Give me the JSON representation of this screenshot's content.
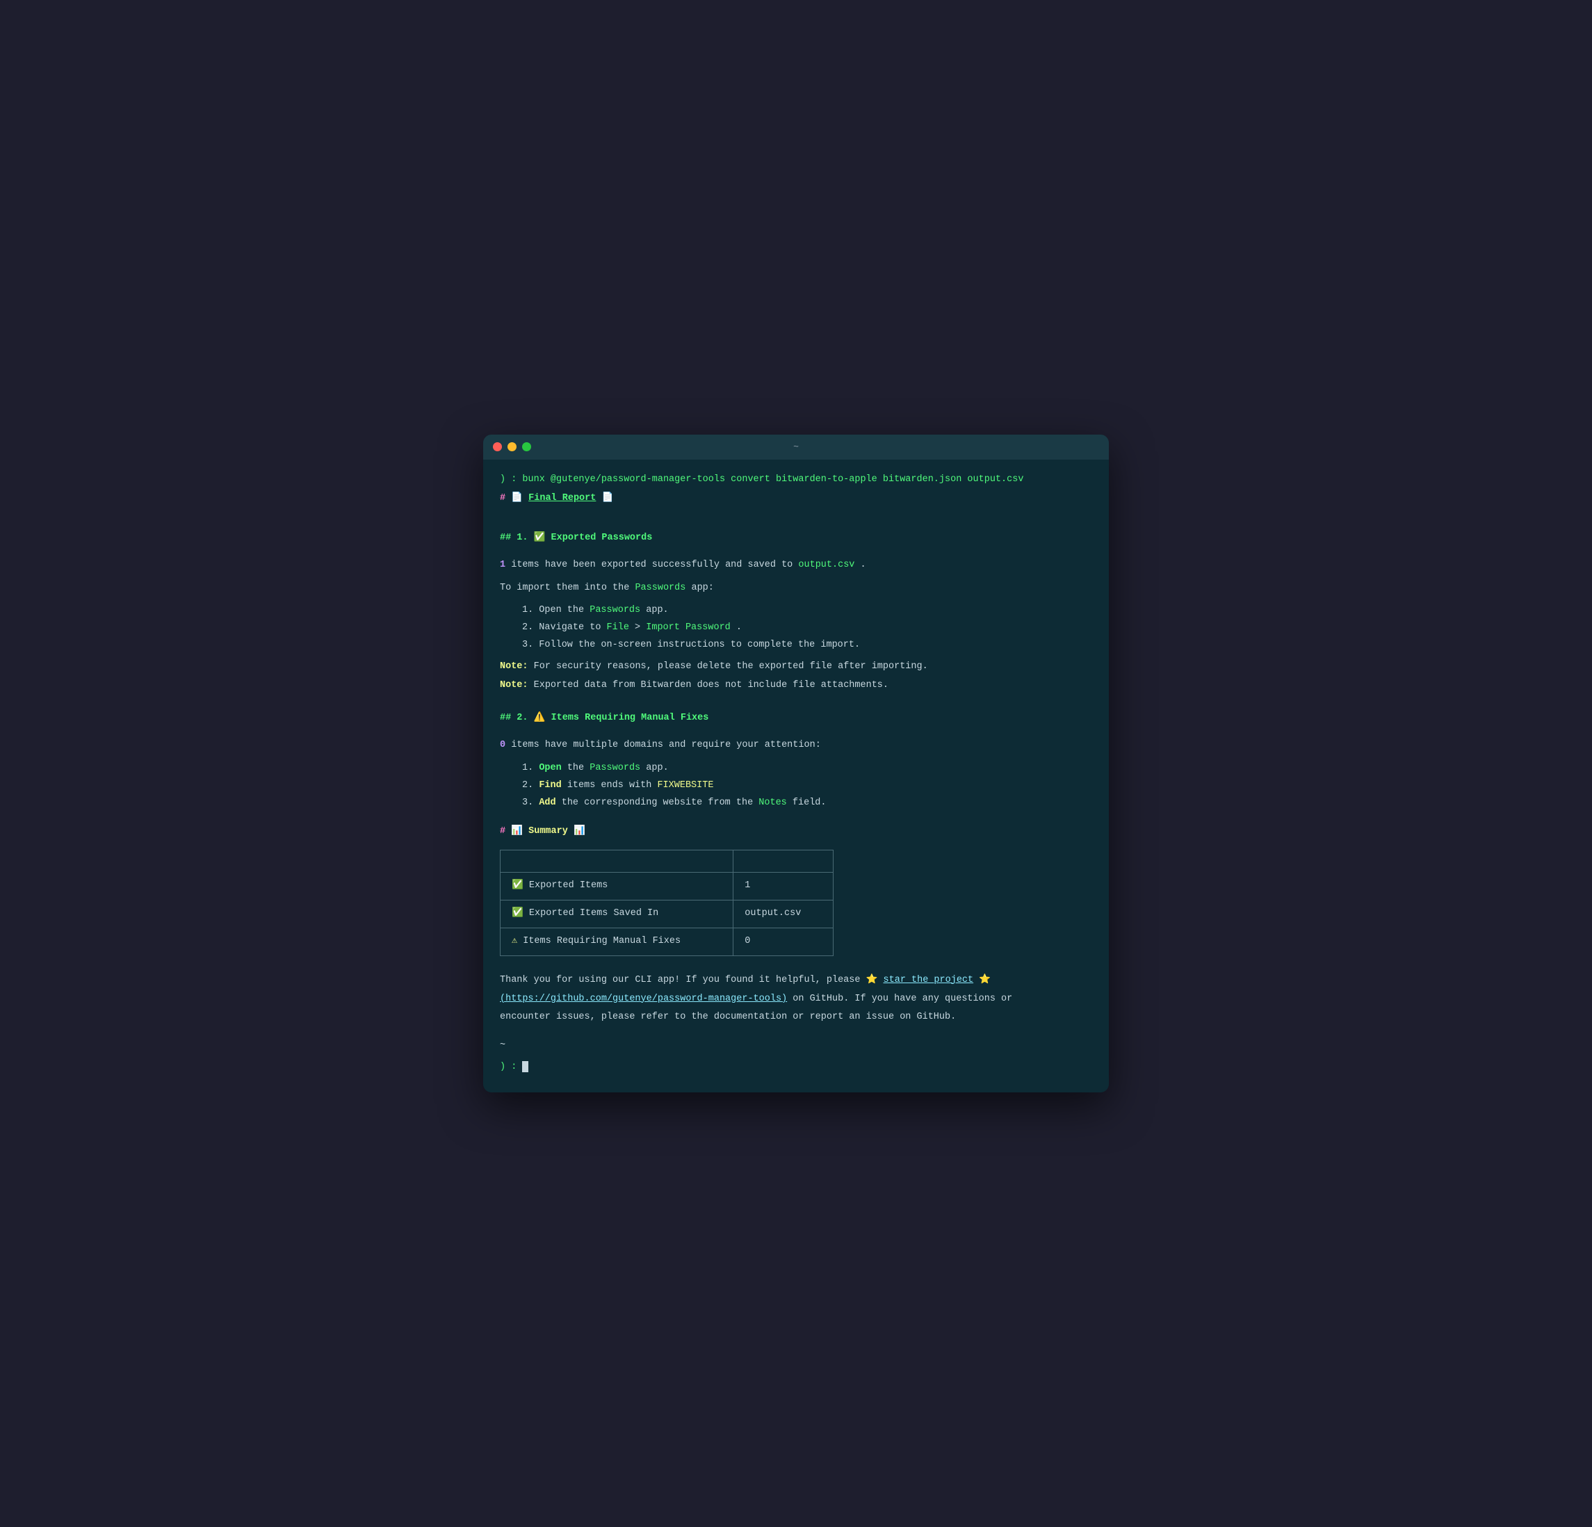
{
  "window": {
    "title": "~"
  },
  "terminal": {
    "command": ") : bunx @gutenye/password-manager-tools convert bitwarden-to-apple bitwarden.json output.csv",
    "h1": {
      "hash": "#",
      "icon1": "📄",
      "label": "Final Report",
      "icon2": "📄"
    },
    "section1": {
      "heading": "## 1. ✅ Exported Passwords",
      "line1_pre": "items have been exported successfully and saved to",
      "line1_code": "output.csv",
      "line1_post": ".",
      "line1_num": "1",
      "import_intro": "To import them into the",
      "import_app": "Passwords",
      "import_intro2": "app:",
      "steps": [
        {
          "num": "1.",
          "pre": "Open the",
          "bold": "Passwords",
          "post": "app."
        },
        {
          "num": "2.",
          "pre": "Navigate to",
          "code1": "File",
          "mid": ">",
          "code2": "Import Password",
          "post": "."
        },
        {
          "num": "3.",
          "pre": "Follow the on-screen instructions to complete the import.",
          "bold": "",
          "post": ""
        }
      ],
      "note1_bold": "Note:",
      "note1_text": "For security reasons, please delete the exported file after importing.",
      "note2_bold": "Note:",
      "note2_text": "Exported data from Bitwarden does not include file attachments."
    },
    "section2": {
      "heading": "## 2. ⚠️ Items Requiring Manual Fixes",
      "line1_num": "0",
      "line1_text": "items have multiple domains and require your attention:",
      "steps": [
        {
          "num": "1.",
          "bold": "Open",
          "pre": "",
          "post": "the",
          "app": "Passwords",
          "end": "app."
        },
        {
          "num": "2.",
          "bold": "Find",
          "pre": "",
          "post": "items ends with",
          "code": "FIXWEBSITE",
          "end": ""
        },
        {
          "num": "3.",
          "bold": "Add",
          "pre": "",
          "post": "the corresponding website from the",
          "code": "Notes",
          "end": "field."
        }
      ]
    },
    "summary": {
      "hash": "#",
      "icon1": "📊",
      "label": "Summary",
      "icon2": "📊",
      "table": {
        "headers": [
          "",
          ""
        ],
        "rows": [
          {
            "icon": "✅",
            "label": "Exported Items",
            "value": "1"
          },
          {
            "icon": "✅",
            "label": "Exported Items Saved In",
            "value": "output.csv"
          },
          {
            "icon": "⚠",
            "label": "Items Requiring Manual Fixes",
            "value": "0"
          }
        ]
      }
    },
    "footer": {
      "line1_pre": "Thank you for using our CLI app! If you found it helpful, please",
      "star1": "⭐",
      "link_text": "star the project",
      "star2": "⭐",
      "line1_post": "",
      "link_url": "https://github.com/gutenye/password-manager-tools",
      "line2_pre": "on GitHub. If you have any questions or",
      "line3": "encounter issues, please refer to the documentation or report an issue on GitHub."
    },
    "tilde": "~",
    "prompt_bottom": ") :"
  }
}
